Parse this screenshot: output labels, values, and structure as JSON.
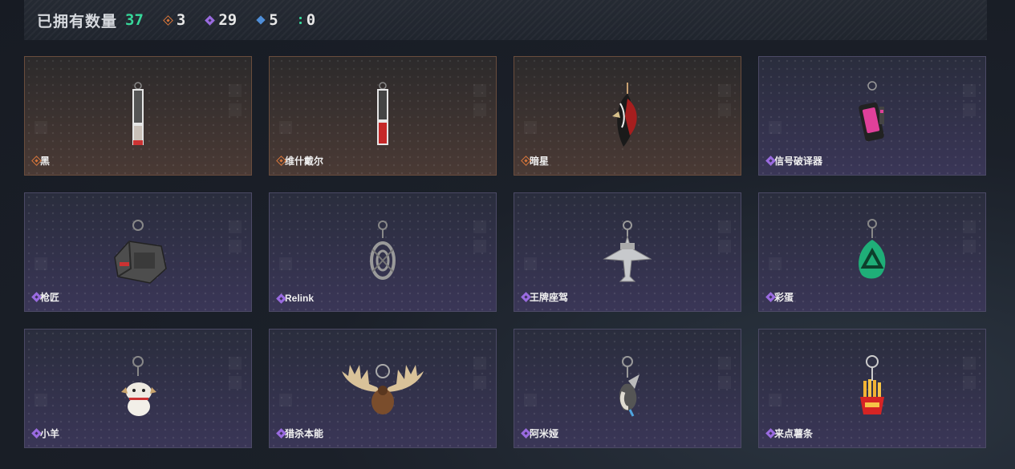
{
  "header": {
    "title": "已拥有数量",
    "total": "37",
    "stats": [
      {
        "icon": "orange-diamond-icon",
        "value": "3",
        "color": "#d9763a"
      },
      {
        "icon": "purple-diamond-icon",
        "value": "29",
        "color": "#9a6be0"
      },
      {
        "icon": "blue-diamond-icon",
        "value": "5",
        "color": "#4f8ed8"
      },
      {
        "icon": "green-dots-icon",
        "value": "0",
        "color": "#37d79a"
      }
    ]
  },
  "items": [
    {
      "name": "黑",
      "rarity": "orange",
      "icon": "card-charm-black-icon"
    },
    {
      "name": "维什戴尔",
      "rarity": "orange",
      "icon": "card-charm-red-icon"
    },
    {
      "name": "暗星",
      "rarity": "orange",
      "icon": "feather-charm-icon"
    },
    {
      "name": "信号破译器",
      "rarity": "purple",
      "icon": "pink-device-charm-icon"
    },
    {
      "name": "枪匠",
      "rarity": "purple",
      "icon": "metal-crate-charm-icon"
    },
    {
      "name": "Relink",
      "rarity": "purple",
      "icon": "ring-emblem-charm-icon"
    },
    {
      "name": "王牌座驾",
      "rarity": "purple",
      "icon": "jet-plane-charm-icon"
    },
    {
      "name": "彩蛋",
      "rarity": "purple",
      "icon": "green-egg-charm-icon"
    },
    {
      "name": "小羊",
      "rarity": "purple",
      "icon": "lamb-charm-icon"
    },
    {
      "name": "猎杀本能",
      "rarity": "purple",
      "icon": "moose-antler-charm-icon"
    },
    {
      "name": "阿米娅",
      "rarity": "purple",
      "icon": "bunny-charm-icon"
    },
    {
      "name": "来点薯条",
      "rarity": "purple",
      "icon": "fries-charm-icon"
    }
  ]
}
